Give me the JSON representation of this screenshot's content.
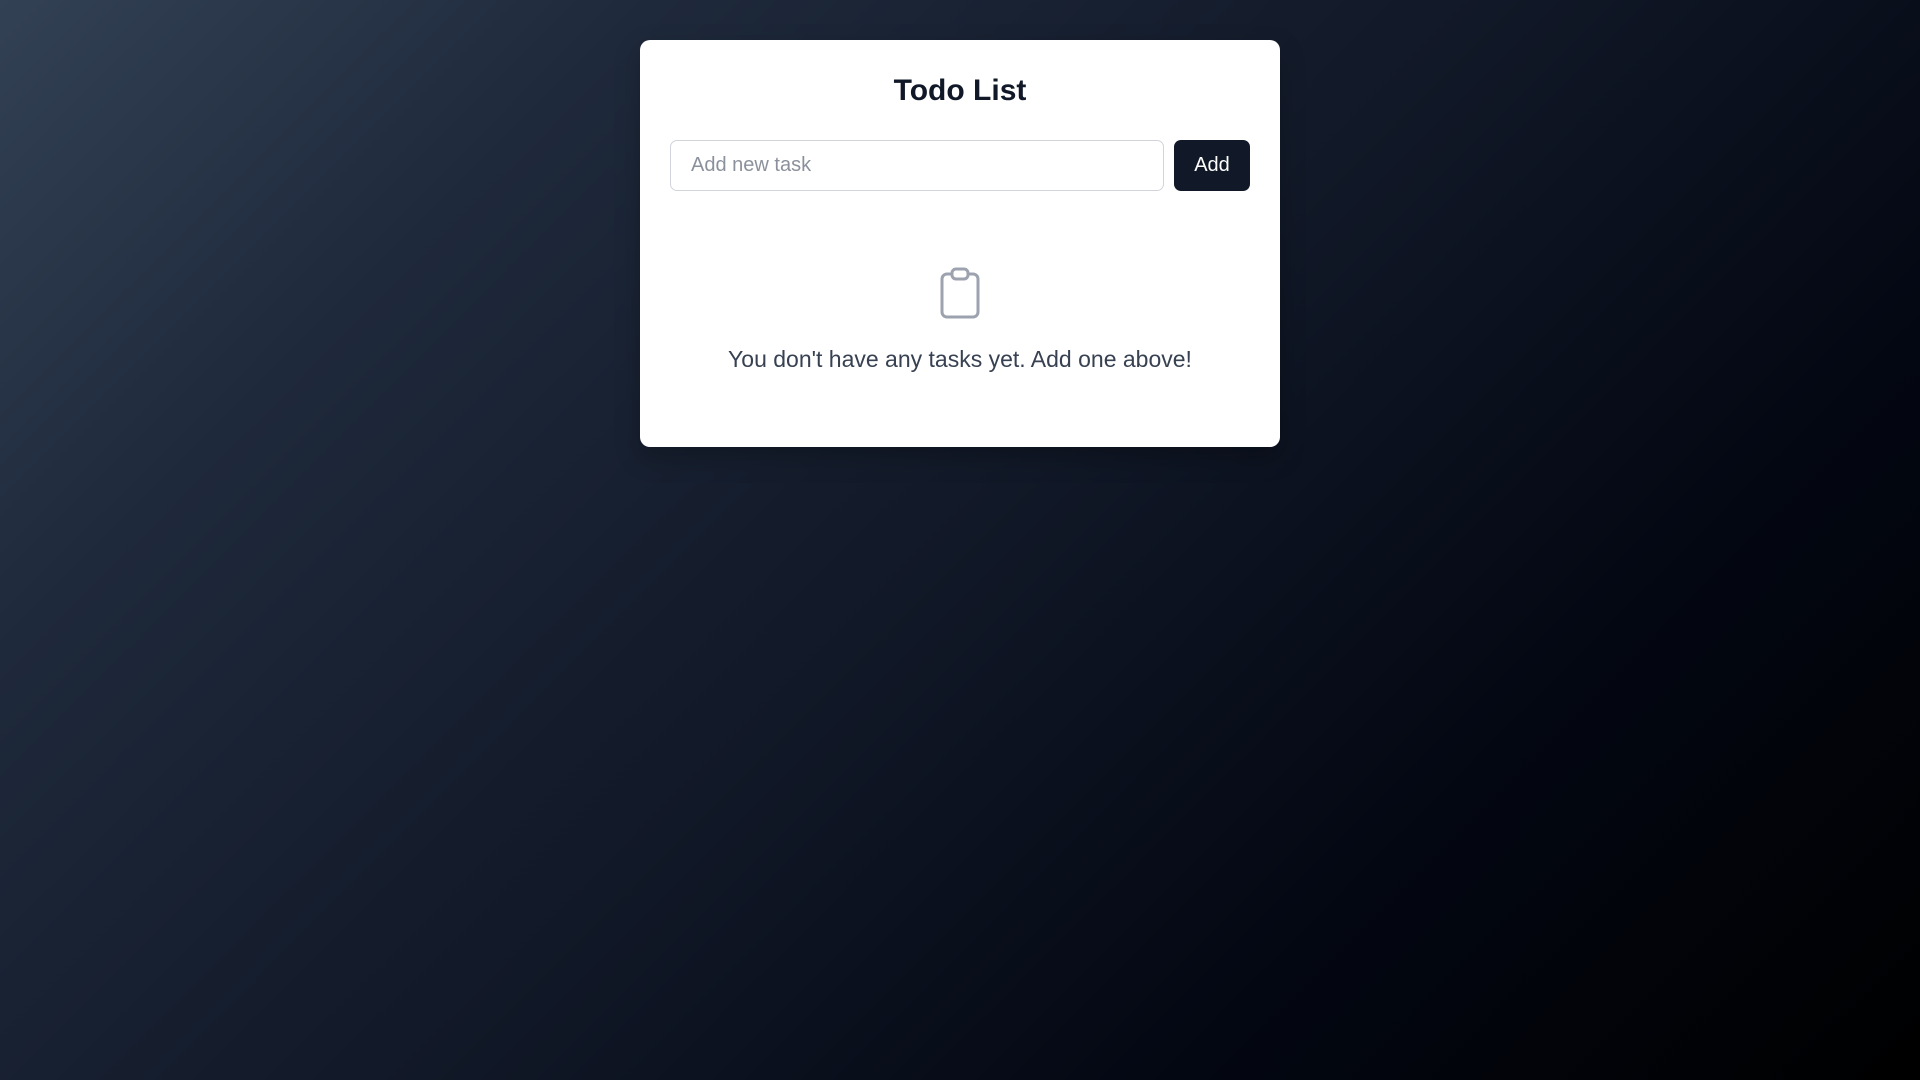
{
  "app": {
    "title": "Todo List"
  },
  "new_task": {
    "placeholder": "Add new task",
    "value": "",
    "add_label": "Add"
  },
  "empty_state": {
    "icon": "clipboard-icon",
    "message": "You don't have any tasks yet. Add one above!"
  },
  "colors": {
    "button_bg": "#111827",
    "icon_stroke": "#9ca3af",
    "card_bg": "#ffffff"
  }
}
